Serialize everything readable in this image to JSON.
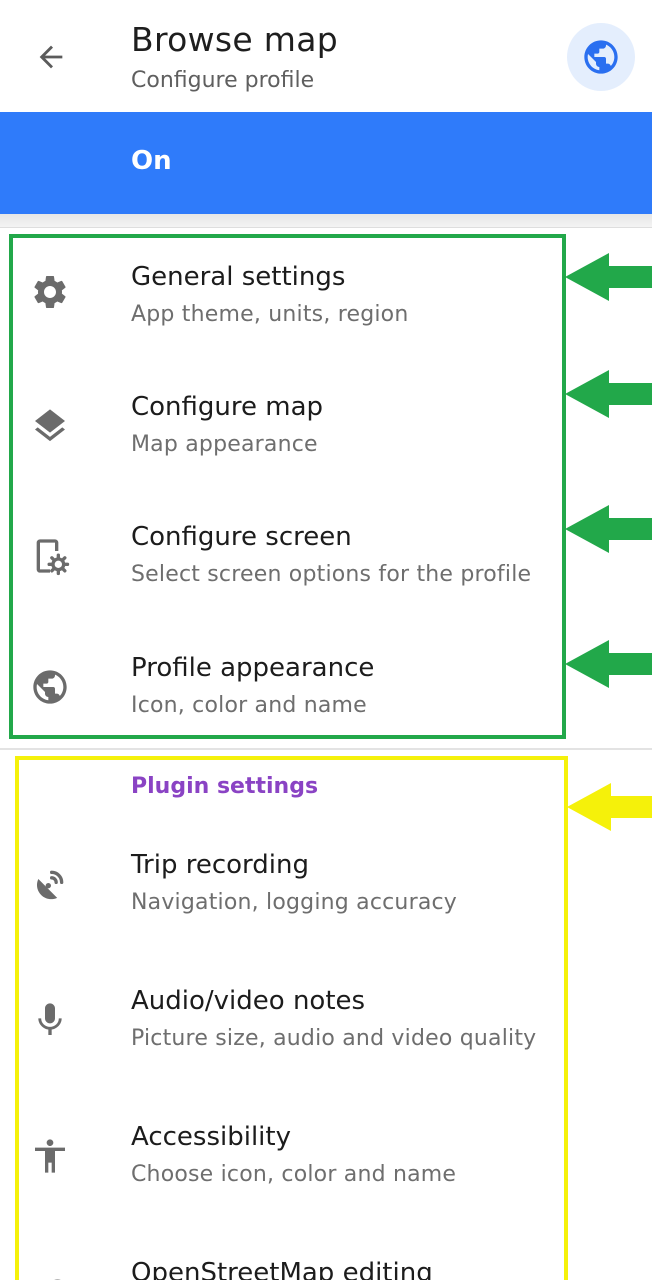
{
  "app_bar": {
    "title": "Browse map",
    "subtitle": "Configure profile",
    "back_icon": "arrow-left-icon",
    "profile_icon": "globe-icon"
  },
  "toggle": {
    "label": "On",
    "color": "#2f7bfa"
  },
  "settings": [
    {
      "title": "General settings",
      "desc": "App theme, units, region",
      "icon": "gear-icon"
    },
    {
      "title": "Configure map",
      "desc": "Map appearance",
      "icon": "layers-icon"
    },
    {
      "title": "Configure screen",
      "desc": "Select screen options for the profile",
      "icon": "screen-settings-icon"
    },
    {
      "title": "Profile appearance",
      "desc": "Icon, color and name",
      "icon": "globe-icon"
    }
  ],
  "plugins": {
    "header": "Plugin settings",
    "header_color": "#8a43c4",
    "items": [
      {
        "title": "Trip recording",
        "desc": "Navigation, logging accuracy",
        "icon": "satellite-dish-icon"
      },
      {
        "title": "Audio/video notes",
        "desc": "Picture size, audio and video quality",
        "icon": "microphone-icon"
      },
      {
        "title": "Accessibility",
        "desc": "Choose icon, color and name",
        "icon": "accessibility-icon"
      },
      {
        "title": "OpenStreetMap editing",
        "desc": "",
        "icon": "osm-icon"
      }
    ]
  },
  "annotations": {
    "green_color": "#22a84a",
    "yellow_color": "#f5f10a"
  }
}
